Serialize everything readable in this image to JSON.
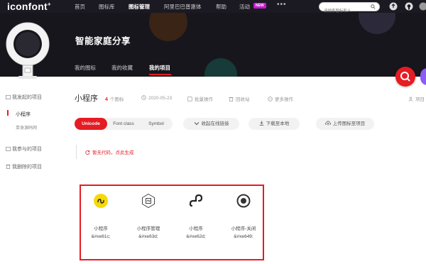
{
  "nav": {
    "logo": "iconfont",
    "logo_mark": "+",
    "items": [
      "首页",
      "图标库",
      "图标管理",
      "阿里巴巴普惠体",
      "帮助",
      "活动"
    ],
    "badge": "NEW",
    "more": "•••",
    "search_placeholder": "请搜索图标和人"
  },
  "project": {
    "title": "智能家庭分享",
    "tabs": [
      "我的图标",
      "我的收藏",
      "我的项目"
    ],
    "name": "小程序",
    "icon_count": "4",
    "icon_count_unit": "个图标",
    "date": "2020-05-23",
    "batch": "批量操作",
    "trash": "回收站",
    "more_ops": "更多操作",
    "right_cut": "项目"
  },
  "sidebar": {
    "section1": "我发起的项目",
    "items": [
      "小程序",
      "单身源码网"
    ],
    "section2": "我参与的项目",
    "section3": "我删除的项目"
  },
  "modes": [
    "Unicode",
    "Font class",
    "Symbol"
  ],
  "actions": {
    "collapse": "收起在线链接",
    "download": "下载至本地",
    "upload": "上传图标至项目"
  },
  "code_note": "暂无代码，点此生成",
  "icons": [
    {
      "name": "小程序",
      "code": "&#xe61c;",
      "icon": "miniapp-yellow-icon"
    },
    {
      "name": "小程序管理",
      "code": "&#xe63d;",
      "icon": "miniapp-manage-icon"
    },
    {
      "name": "小程序",
      "code": "&#xe62d;",
      "icon": "miniapp-s-icon"
    },
    {
      "name": "小程序-关闭",
      "code": "&#xe649;",
      "icon": "miniapp-close-icon"
    }
  ],
  "colors": {
    "accent": "#e51c23",
    "header_bg": "#17161d",
    "highlight": "#f5d90a"
  }
}
